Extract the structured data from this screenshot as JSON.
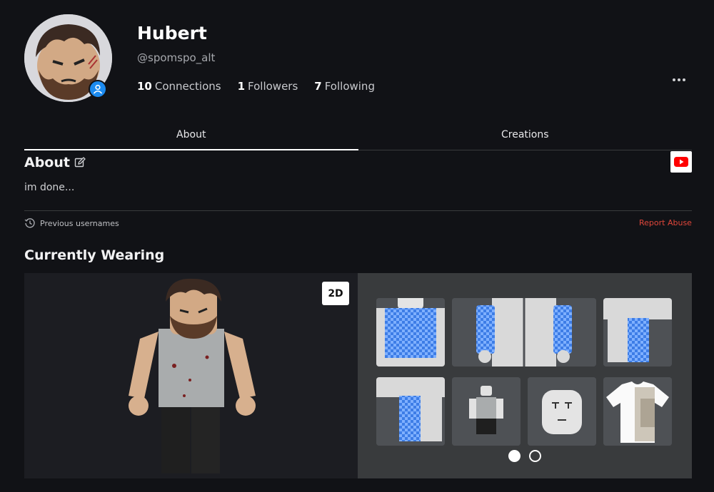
{
  "profile": {
    "display_name": "Hubert",
    "username": "@spomspo_alt",
    "stats": [
      {
        "count": "10",
        "label": "Connections"
      },
      {
        "count": "1",
        "label": "Followers"
      },
      {
        "count": "7",
        "label": "Following"
      }
    ]
  },
  "tabs": [
    {
      "label": "About",
      "active": true
    },
    {
      "label": "Creations",
      "active": false
    }
  ],
  "about": {
    "title": "About",
    "bio": "im done...",
    "previous_usernames_label": "Previous usernames",
    "report_abuse_label": "Report Abuse"
  },
  "wearing": {
    "title": "Currently Wearing",
    "toggle_2d_label": "2D",
    "page_count": 2,
    "current_page": 1
  },
  "colors": {
    "background": "#111216",
    "accent_blue": "#1c8bf0",
    "report_red": "#e0463a",
    "youtube_red": "#ff0000"
  }
}
